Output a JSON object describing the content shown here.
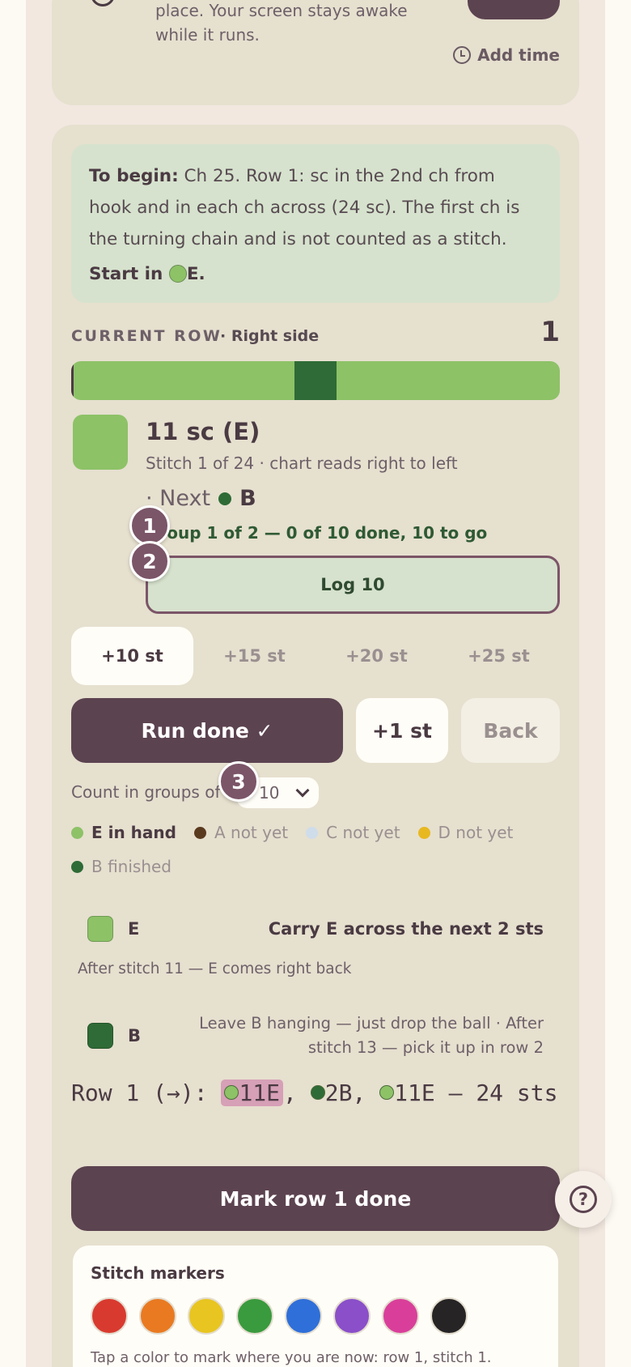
{
  "timer": {
    "text": "place. Your screen stays awake while it runs.",
    "add_time": "Add time"
  },
  "instructions": {
    "lead": "To begin:",
    "body": "Ch 25. Row 1: sc in the 2nd ch from hook and in each ch across (24 sc). The first ch is the turning chain and is not counted as a stitch.",
    "start_prefix": "Start in",
    "start_color": "E",
    "start_suffix": "."
  },
  "current_row": {
    "label": "CURRENT ROW",
    "side": "· Right side",
    "number": "1",
    "progress_fraction": 0.04
  },
  "stitch": {
    "title": "11 sc (E)",
    "subtitle": "Stitch 1 of 24 · chart reads right to left",
    "next_prefix": "· Next",
    "next_color": "B",
    "group_status": "Group 1 of 2 — 0 of 10 done, 10 to go",
    "log_button": "Log 10"
  },
  "badges": [
    "1",
    "2",
    "3"
  ],
  "increments": [
    {
      "label": "+10 st",
      "active": true
    },
    {
      "label": "+15 st",
      "active": false
    },
    {
      "label": "+20 st",
      "active": false
    },
    {
      "label": "+25 st",
      "active": false
    }
  ],
  "actions": {
    "run_done": "Run done ✓",
    "plus_one": "+1 st",
    "back": "Back"
  },
  "count": {
    "label": "Count in groups of",
    "value": "10"
  },
  "legend": [
    {
      "color": "#8dc267",
      "text": "E in hand",
      "on": true
    },
    {
      "color": "#5a3a1e",
      "text": "A not yet",
      "on": false
    },
    {
      "color": "#cfdcea",
      "text": "C not yet",
      "on": false
    },
    {
      "color": "#e8b820",
      "text": "D not yet",
      "on": false
    },
    {
      "color": "#2f6b36",
      "text": "B finished",
      "on": false
    }
  ],
  "carry": {
    "color": "E",
    "swatch": "#8dc267",
    "description": "Carry E across the next 2 sts",
    "after": "After stitch 11 — E comes right back"
  },
  "leave": {
    "color": "B",
    "swatch": "#2f6b36",
    "description": "Leave B hanging — just drop the ball · After stitch 13 — pick it up in row 2"
  },
  "pattern": {
    "prefix": "Row 1 (→): ",
    "seg1": "11E",
    "sep1": ", ",
    "seg2": "2B",
    "sep2": ", ",
    "seg3": "11E",
    "suffix": " — 24 sts"
  },
  "mark_row": "Mark row 1 done",
  "markers": {
    "title": "Stitch markers",
    "colors": [
      "#d93a2f",
      "#e97a22",
      "#e8c520",
      "#3a9a3e",
      "#2f6fd9",
      "#8a4fc9",
      "#d93f9a",
      "#262424"
    ],
    "hint": "Tap a color to mark where you are now: row 1, stitch 1."
  },
  "colors": {
    "E": "#8dc267",
    "B": "#2f6b36",
    "accent": "#5c4350"
  }
}
